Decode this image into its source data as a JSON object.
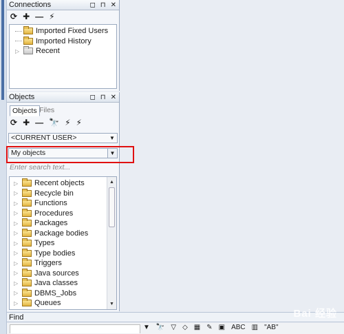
{
  "connections_pane": {
    "title": "Connections",
    "window_controls": [
      "◻",
      "⊓",
      "✕"
    ],
    "toolbar_icons": [
      "⟳",
      "✚",
      "—",
      "⚡"
    ],
    "tree": [
      {
        "label": "Imported Fixed Users"
      },
      {
        "label": "Imported History"
      },
      {
        "label": "Recent"
      }
    ]
  },
  "objects_pane": {
    "title": "Objects",
    "window_controls": [
      "◻",
      "⊓",
      "✕"
    ],
    "tabs": [
      "Objects",
      "Files"
    ],
    "toolbar_icons": [
      "⟳",
      "✚",
      "—",
      "🔭",
      "⚡",
      "⚡"
    ],
    "user_combo": "<CURRENT USER>",
    "objects_combo": "My objects",
    "search_placeholder": "Enter search text...",
    "tree": [
      "Recent objects",
      "Recycle bin",
      "Functions",
      "Procedures",
      "Packages",
      "Package bodies",
      "Types",
      "Type bodies",
      "Triggers",
      "Java sources",
      "Java classes",
      "DBMS_Jobs",
      "Queues"
    ]
  },
  "find_bar": {
    "label": "Find",
    "tools": [
      "▼",
      "🔭",
      "▽",
      "◇",
      "▦",
      "✎",
      "▣",
      "ABC",
      "▥",
      "\"AB\""
    ]
  },
  "watermark": "Bai 经验"
}
